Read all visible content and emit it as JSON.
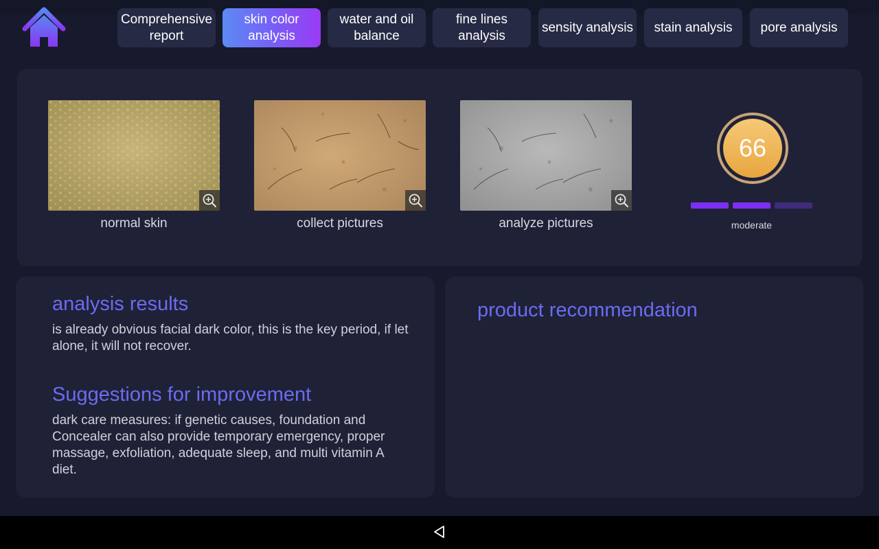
{
  "tabs": [
    {
      "label": "Comprehensive report",
      "active": false
    },
    {
      "label": "skin color analysis",
      "active": true
    },
    {
      "label": "water and oil balance",
      "active": false
    },
    {
      "label": "fine lines analysis",
      "active": false
    },
    {
      "label": "sensity analysis",
      "active": false
    },
    {
      "label": "stain analysis",
      "active": false
    },
    {
      "label": "pore analysis",
      "active": false
    }
  ],
  "images": [
    {
      "caption": "normal skin"
    },
    {
      "caption": "collect pictures"
    },
    {
      "caption": "analyze pictures"
    }
  ],
  "score": {
    "value": "66",
    "level_label": "moderate",
    "level_filled": 2,
    "level_total": 3
  },
  "analysis": {
    "title": "analysis results",
    "text": "is already obvious facial dark color, this is the key period, if let alone, it will not recover."
  },
  "suggestions": {
    "title": "Suggestions for improvement",
    "text": "dark care measures: if genetic causes, foundation and Concealer can also provide temporary emergency, proper massage, exfoliation, adequate sleep, and multi vitamin A diet."
  },
  "recommendation": {
    "title": "product recommendation"
  },
  "colors": {
    "background": "#171a2c",
    "panel": "#1f2137",
    "accent_title": "#6a6cf0",
    "active_tab_start": "#5b8bf5",
    "active_tab_end": "#9a3bf4",
    "level_bar": "#7b2ff2",
    "score_gold": "#f0b24e"
  },
  "icons": {
    "home": "home-icon",
    "zoom": "zoom-in-icon",
    "back": "back-triangle-icon"
  }
}
